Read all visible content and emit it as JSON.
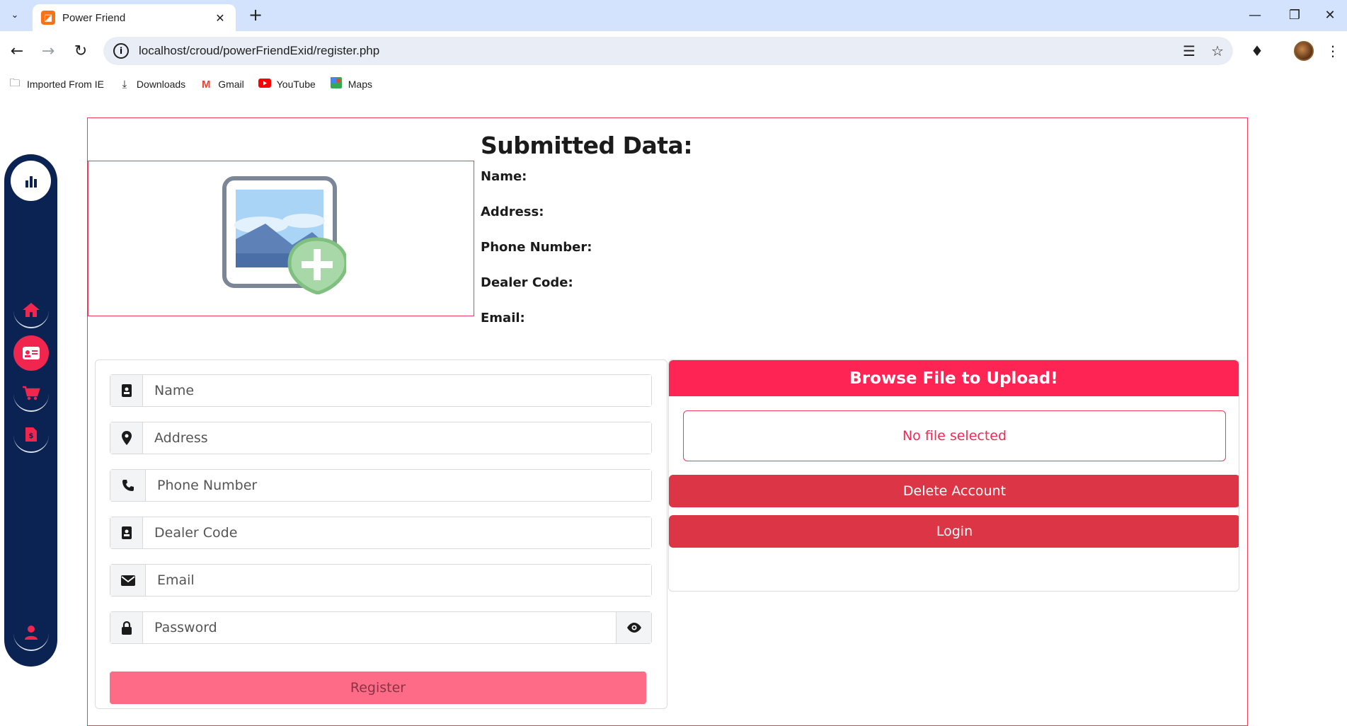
{
  "browser": {
    "tab_title": "Power Friend",
    "url": "localhost/croud/powerFriendExid/register.php",
    "bookmarks": [
      "Imported From IE",
      "Downloads",
      "Gmail",
      "YouTube",
      "Maps"
    ]
  },
  "submitted": {
    "heading": "Submitted Data:",
    "labels": [
      "Name:",
      "Address:",
      "Phone Number:",
      "Dealer Code:",
      "Email:"
    ]
  },
  "form": {
    "name_placeholder": "Name",
    "address_placeholder": "Address",
    "phone_placeholder": "Phone Number",
    "dealer_placeholder": "Dealer Code",
    "email_placeholder": "Email",
    "password_placeholder": "Password",
    "register_label": "Register"
  },
  "upload": {
    "header": "Browse File to Upload!",
    "file_status": "No file selected",
    "delete_label": "Delete Account",
    "login_label": "Login"
  },
  "colors": {
    "accent": "#fe2555",
    "sidebar": "#0a2352",
    "danger": "#dc3545",
    "register": "#fe6b87"
  }
}
